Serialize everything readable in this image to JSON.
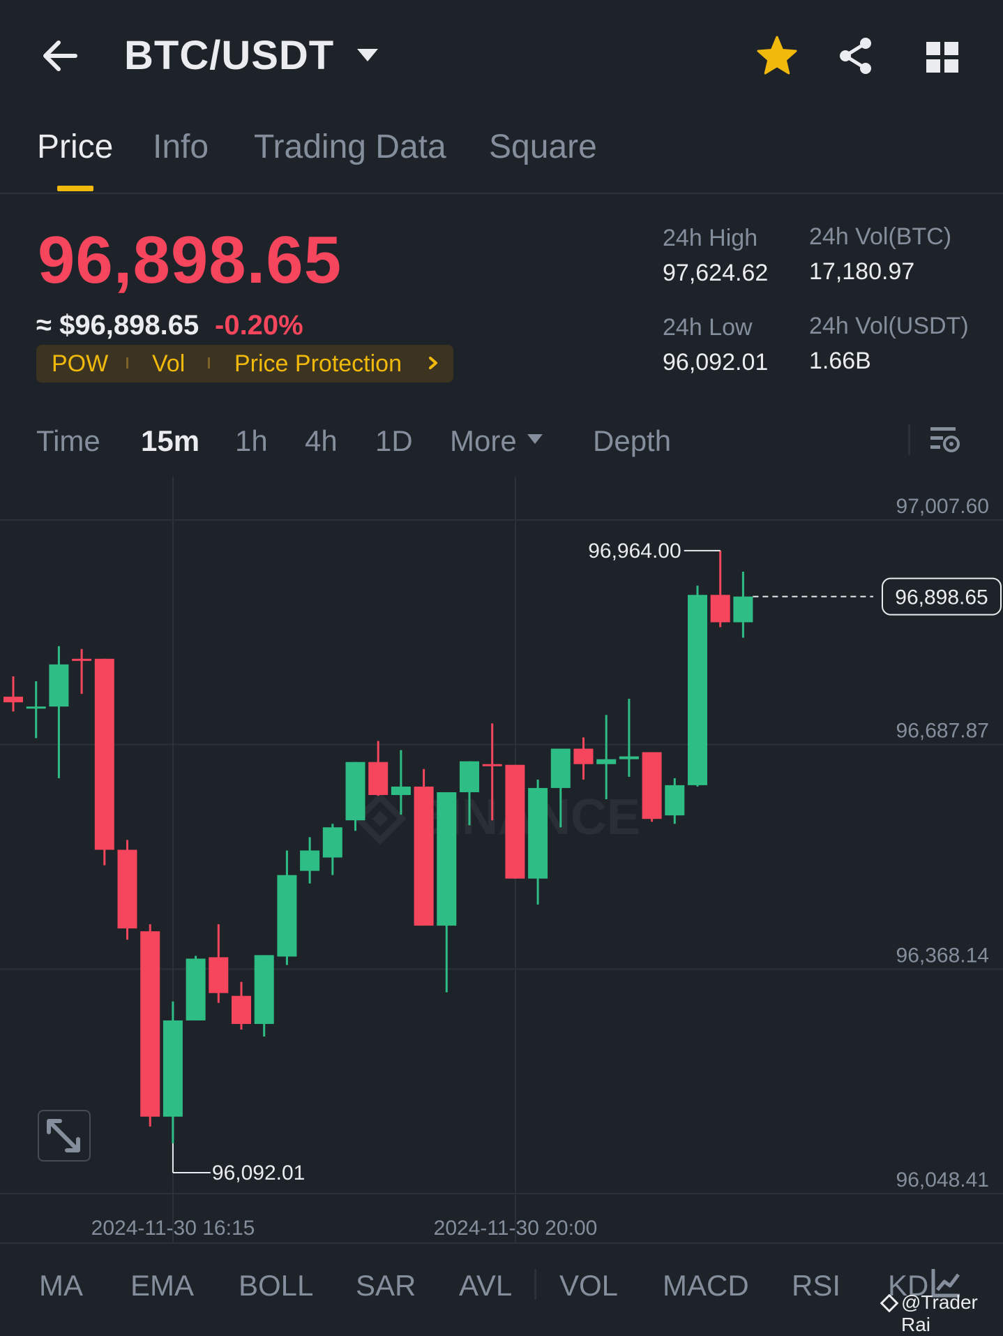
{
  "header": {
    "pair": "BTC/USDT",
    "back_icon": "arrow-left-icon",
    "favorite_icon": "star-icon",
    "share_icon": "share-icon",
    "layout_icon": "grid-icon"
  },
  "tabs": [
    {
      "label": "Price",
      "active": true
    },
    {
      "label": "Info",
      "active": false
    },
    {
      "label": "Trading Data",
      "active": false
    },
    {
      "label": "Square",
      "active": false
    }
  ],
  "price": {
    "last": "96,898.65",
    "approx_usd": "≈ $96,898.65",
    "change_pct": "-0.20%",
    "tags": [
      "POW",
      "Vol",
      "Price Protection"
    ]
  },
  "stats": {
    "high_label": "24h High",
    "high_value": "97,624.62",
    "low_label": "24h Low",
    "low_value": "96,092.01",
    "vol_btc_label": "24h Vol(BTC)",
    "vol_btc_value": "17,180.97",
    "vol_usdt_label": "24h Vol(USDT)",
    "vol_usdt_value": "1.66B"
  },
  "intervals": {
    "items": [
      "Time",
      "15m",
      "1h",
      "4h",
      "1D",
      "More",
      "Depth"
    ],
    "active": "15m"
  },
  "indicators": [
    "MA",
    "EMA",
    "BOLL",
    "SAR",
    "AVL",
    "VOL",
    "MACD",
    "RSI",
    "KD"
  ],
  "watermark": {
    "brand": "BINANCE",
    "credit": "@Trader Rai"
  },
  "colors": {
    "up": "#2ebd85",
    "down": "#f6465d",
    "accent": "#f0b90b",
    "bg": "#1e2329"
  },
  "chart_data": {
    "type": "candlestick",
    "y_ticks": [
      "97,007.60",
      "96,687.87",
      "96,368.14",
      "96,048.41"
    ],
    "ylim": [
      96048.41,
      97007.6
    ],
    "x_ticks": [
      "2024-11-30 16:15",
      "2024-11-30 20:00"
    ],
    "current_price_label": "96,898.65",
    "high_marker_label": "96,964.00",
    "low_marker_label": "96,092.01",
    "grid": true,
    "candles": [
      {
        "o": 96756,
        "h": 96785,
        "l": 96735,
        "c": 96748
      },
      {
        "o": 96742,
        "h": 96778,
        "l": 96697,
        "c": 96742
      },
      {
        "o": 96742,
        "h": 96828,
        "l": 96640,
        "c": 96802
      },
      {
        "o": 96810,
        "h": 96824,
        "l": 96760,
        "c": 96808
      },
      {
        "o": 96810,
        "h": 96810,
        "l": 96516,
        "c": 96538
      },
      {
        "o": 96538,
        "h": 96552,
        "l": 96410,
        "c": 96426
      },
      {
        "o": 96422,
        "h": 96432,
        "l": 96144,
        "c": 96158
      },
      {
        "o": 96158,
        "h": 96322,
        "l": 96120,
        "c": 96295
      },
      {
        "o": 96295,
        "h": 96387,
        "l": 96307,
        "c": 96383
      },
      {
        "o": 96385,
        "h": 96432,
        "l": 96320,
        "c": 96334
      },
      {
        "o": 96330,
        "h": 96350,
        "l": 96282,
        "c": 96290
      },
      {
        "o": 96290,
        "h": 96386,
        "l": 96272,
        "c": 96388
      },
      {
        "o": 96386,
        "h": 96537,
        "l": 96374,
        "c": 96502
      },
      {
        "o": 96508,
        "h": 96556,
        "l": 96490,
        "c": 96537
      },
      {
        "o": 96527,
        "h": 96575,
        "l": 96502,
        "c": 96570
      },
      {
        "o": 96580,
        "h": 96660,
        "l": 96565,
        "c": 96663
      },
      {
        "o": 96663,
        "h": 96693,
        "l": 96615,
        "c": 96616
      },
      {
        "o": 96616,
        "h": 96680,
        "l": 96588,
        "c": 96628
      },
      {
        "o": 96628,
        "h": 96653,
        "l": 96437,
        "c": 96430
      },
      {
        "o": 96430,
        "h": 96618,
        "l": 96335,
        "c": 96620
      },
      {
        "o": 96620,
        "h": 96635,
        "l": 96573,
        "c": 96664
      },
      {
        "o": 96660,
        "h": 96718,
        "l": 96580,
        "c": 96659
      },
      {
        "o": 96659,
        "h": 96620,
        "l": 96500,
        "c": 96497
      },
      {
        "o": 96497,
        "h": 96638,
        "l": 96460,
        "c": 96626
      },
      {
        "o": 96626,
        "h": 96646,
        "l": 96570,
        "c": 96682
      },
      {
        "o": 96682,
        "h": 96698,
        "l": 96638,
        "c": 96660
      },
      {
        "o": 96660,
        "h": 96730,
        "l": 96610,
        "c": 96667
      },
      {
        "o": 96667,
        "h": 96753,
        "l": 96642,
        "c": 96671
      },
      {
        "o": 96677,
        "h": 96675,
        "l": 96578,
        "c": 96582
      },
      {
        "o": 96587,
        "h": 96640,
        "l": 96575,
        "c": 96630
      },
      {
        "o": 96630,
        "h": 96914,
        "l": 96628,
        "c": 96901
      },
      {
        "o": 96901,
        "h": 96964,
        "l": 96855,
        "c": 96862
      },
      {
        "o": 96862,
        "h": 96934,
        "l": 96840,
        "c": 96898.65
      }
    ]
  }
}
